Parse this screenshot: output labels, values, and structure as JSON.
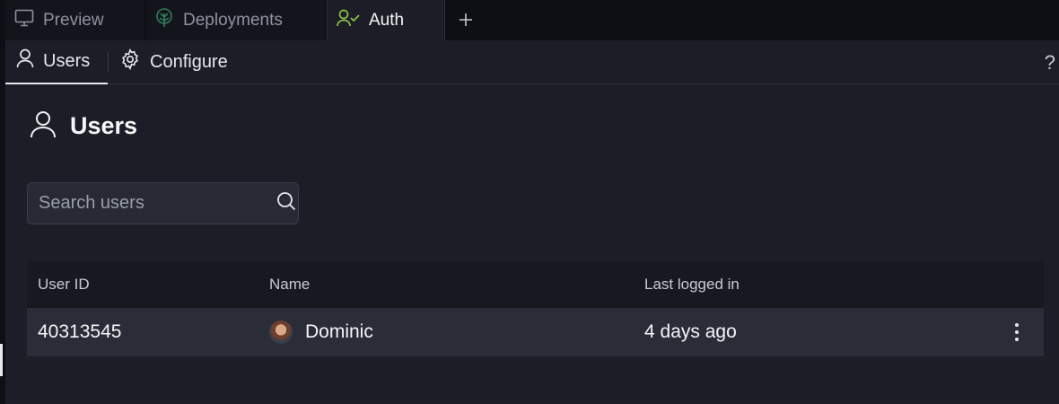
{
  "tabs": [
    {
      "label": "Preview",
      "icon": "monitor-icon",
      "active": false
    },
    {
      "label": "Deployments",
      "icon": "deployments-icon",
      "active": false
    },
    {
      "label": "Auth",
      "icon": "user-check-icon",
      "active": true
    }
  ],
  "add_tab_icon": "plus-icon",
  "subnav": {
    "items": [
      {
        "label": "Users",
        "icon": "user-icon",
        "active": true
      },
      {
        "label": "Configure",
        "icon": "gear-icon",
        "active": false
      }
    ],
    "help_label": "?"
  },
  "page": {
    "title": "Users",
    "title_icon": "user-icon"
  },
  "search": {
    "placeholder": "Search users",
    "value": ""
  },
  "table": {
    "columns": [
      "User ID",
      "Name",
      "Last logged in"
    ],
    "rows": [
      {
        "user_id": "40313545",
        "name": "Dominic",
        "last_logged_in": "4 days ago"
      }
    ]
  },
  "colors": {
    "background": "#1c1d26",
    "tabbar": "#0e0f15",
    "accent_green": "#8bc34a",
    "row_bg": "#2a2c37"
  }
}
